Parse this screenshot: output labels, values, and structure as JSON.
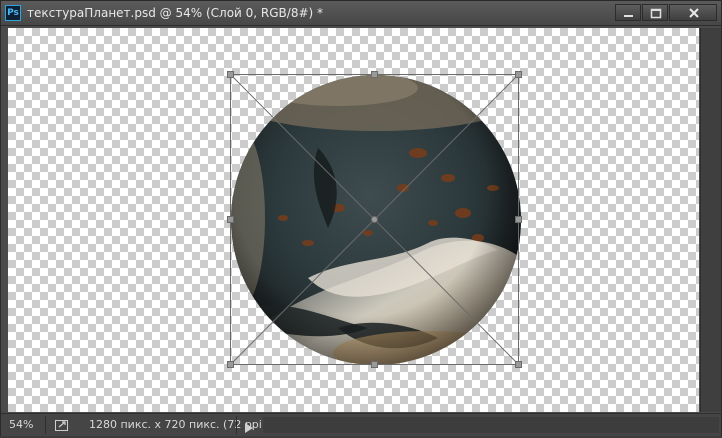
{
  "app": {
    "icon_label": "Ps"
  },
  "document": {
    "title": "текстураПланет.psd @ 54% (Слой 0, RGB/8#) *"
  },
  "window_controls": {
    "minimize_icon": "minimize-icon",
    "maximize_icon": "maximize-icon",
    "close_icon": "close-icon"
  },
  "status_bar": {
    "zoom": "54%",
    "doc_info": "1280 пикс. x 720 пикс. (72 ppi)"
  },
  "colors": {
    "chrome": "#4a4a4a",
    "titlebar": "#535353",
    "accent_ps": "#2fa3e0",
    "checker_light": "#ffffff",
    "checker_dark": "#cccccc"
  }
}
